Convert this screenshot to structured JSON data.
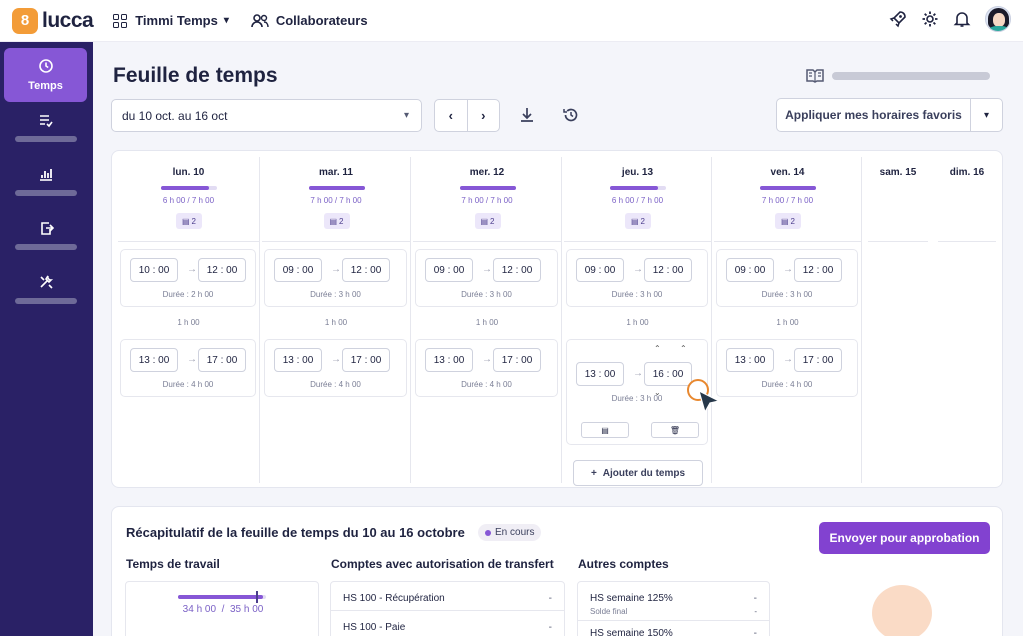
{
  "topbar": {
    "brand": "lucca",
    "app_name": "Timmi Temps",
    "collaborators_label": "Collaborateurs"
  },
  "sidebar": {
    "items": [
      {
        "label": "Temps",
        "icon": "clock-icon",
        "active": true
      },
      {
        "label": "",
        "icon": "checklist-icon"
      },
      {
        "label": "",
        "icon": "chart-icon"
      },
      {
        "label": "",
        "icon": "export-icon"
      },
      {
        "label": "",
        "icon": "tools-icon"
      }
    ]
  },
  "header": {
    "title": "Feuille de temps",
    "period": "du 10 oct. au 16 oct",
    "prev_label": "‹",
    "next_label": "›",
    "apply_label": "Appliquer mes horaires favoris"
  },
  "days": [
    {
      "name": "lun. 10",
      "done": "6 h 00",
      "target": "7 h 00",
      "progress": 0.86,
      "comments": "2",
      "slots": [
        {
          "start_h": "10",
          "start_m": "00",
          "end_h": "12",
          "end_m": "00",
          "duree": "Durée : 2 h 00"
        },
        {
          "start_h": "13",
          "start_m": "00",
          "end_h": "17",
          "end_m": "00",
          "duree": "Durée : 4 h 00"
        }
      ],
      "pause": "1 h 00"
    },
    {
      "name": "mar. 11",
      "done": "7 h 00",
      "target": "7 h 00",
      "progress": 1.0,
      "comments": "2",
      "slots": [
        {
          "start_h": "09",
          "start_m": "00",
          "end_h": "12",
          "end_m": "00",
          "duree": "Durée : 3 h 00"
        },
        {
          "start_h": "13",
          "start_m": "00",
          "end_h": "17",
          "end_m": "00",
          "duree": "Durée : 4 h 00"
        }
      ],
      "pause": "1 h 00"
    },
    {
      "name": "mer. 12",
      "done": "7 h 00",
      "target": "7 h 00",
      "progress": 1.0,
      "comments": "2",
      "slots": [
        {
          "start_h": "09",
          "start_m": "00",
          "end_h": "12",
          "end_m": "00",
          "duree": "Durée : 3 h 00"
        },
        {
          "start_h": "13",
          "start_m": "00",
          "end_h": "17",
          "end_m": "00",
          "duree": "Durée : 4 h 00"
        }
      ],
      "pause": "1 h 00"
    },
    {
      "name": "jeu. 13",
      "done": "6 h 00",
      "target": "7 h 00",
      "progress": 0.86,
      "comments": "2",
      "slots": [
        {
          "start_h": "09",
          "start_m": "00",
          "end_h": "12",
          "end_m": "00",
          "duree": "Durée : 3 h 00"
        },
        {
          "start_h": "13",
          "start_m": "00",
          "end_h": "16",
          "end_m": "00",
          "duree": "Durée : 3 h 00"
        }
      ],
      "pause": "1 h 00",
      "add_label": "Ajouter du temps"
    },
    {
      "name": "ven. 14",
      "done": "7 h 00",
      "target": "7 h 00",
      "progress": 1.0,
      "comments": "2",
      "slots": [
        {
          "start_h": "09",
          "start_m": "00",
          "end_h": "12",
          "end_m": "00",
          "duree": "Durée : 3 h 00"
        },
        {
          "start_h": "13",
          "start_m": "00",
          "end_h": "17",
          "end_m": "00",
          "duree": "Durée : 4 h 00"
        }
      ],
      "pause": "1 h 00"
    },
    {
      "name": "sam. 15"
    },
    {
      "name": "dim. 16"
    }
  ],
  "summary": {
    "title": "Récapitulatif de la feuille de temps du 10 au 16 octobre",
    "status": "En cours",
    "send_label": "Envoyer pour approbation",
    "work_time": {
      "title": "Temps de travail",
      "done": "34 h 00",
      "target": "35 h 00",
      "progress": 0.97
    },
    "transfer": {
      "title": "Comptes avec autorisation de transfert",
      "rows": [
        {
          "label": "HS 100 - Récupération",
          "value": "-"
        },
        {
          "label": "HS 100 - Paie",
          "value": "-"
        }
      ]
    },
    "others": {
      "title": "Autres comptes",
      "rows": [
        {
          "label": "HS semaine 125%",
          "sub": "Solde final",
          "value": "-",
          "sub_value": "-"
        },
        {
          "label": "HS semaine 150%",
          "value": "-"
        }
      ]
    }
  },
  "colors": {
    "accent": "#8657d6",
    "sidebar": "#2a2166",
    "primary_button": "#8242d0"
  }
}
